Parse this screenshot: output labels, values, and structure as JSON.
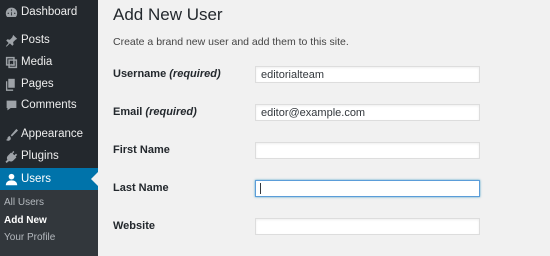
{
  "sidebar": {
    "items": [
      {
        "label": "Dashboard",
        "icon": "dashboard-icon"
      },
      {
        "label": "Posts",
        "icon": "pin-icon"
      },
      {
        "label": "Media",
        "icon": "media-icon"
      },
      {
        "label": "Pages",
        "icon": "pages-icon"
      },
      {
        "label": "Comments",
        "icon": "comment-icon"
      },
      {
        "label": "Appearance",
        "icon": "brush-icon"
      },
      {
        "label": "Plugins",
        "icon": "plug-icon"
      },
      {
        "label": "Users",
        "icon": "user-icon"
      }
    ],
    "active_item": "Users",
    "submenu": [
      {
        "label": "All Users"
      },
      {
        "label": "Add New"
      },
      {
        "label": "Your Profile"
      }
    ],
    "current_submenu": "Add New"
  },
  "main": {
    "title": "Add New User",
    "description": "Create a brand new user and add them to this site.",
    "fields": [
      {
        "label": "Username",
        "required": "(required)",
        "value": "editorialteam"
      },
      {
        "label": "Email",
        "required": "(required)",
        "value": "editor@example.com"
      },
      {
        "label": "First Name",
        "required": "",
        "value": ""
      },
      {
        "label": "Last Name",
        "required": "",
        "value": ""
      },
      {
        "label": "Website",
        "required": "",
        "value": ""
      }
    ],
    "focused_field": "Last Name"
  },
  "colors": {
    "sidebar_bg": "#23282d",
    "submenu_bg": "#32373c",
    "accent": "#0073aa",
    "page_bg": "#f1f1f1"
  }
}
